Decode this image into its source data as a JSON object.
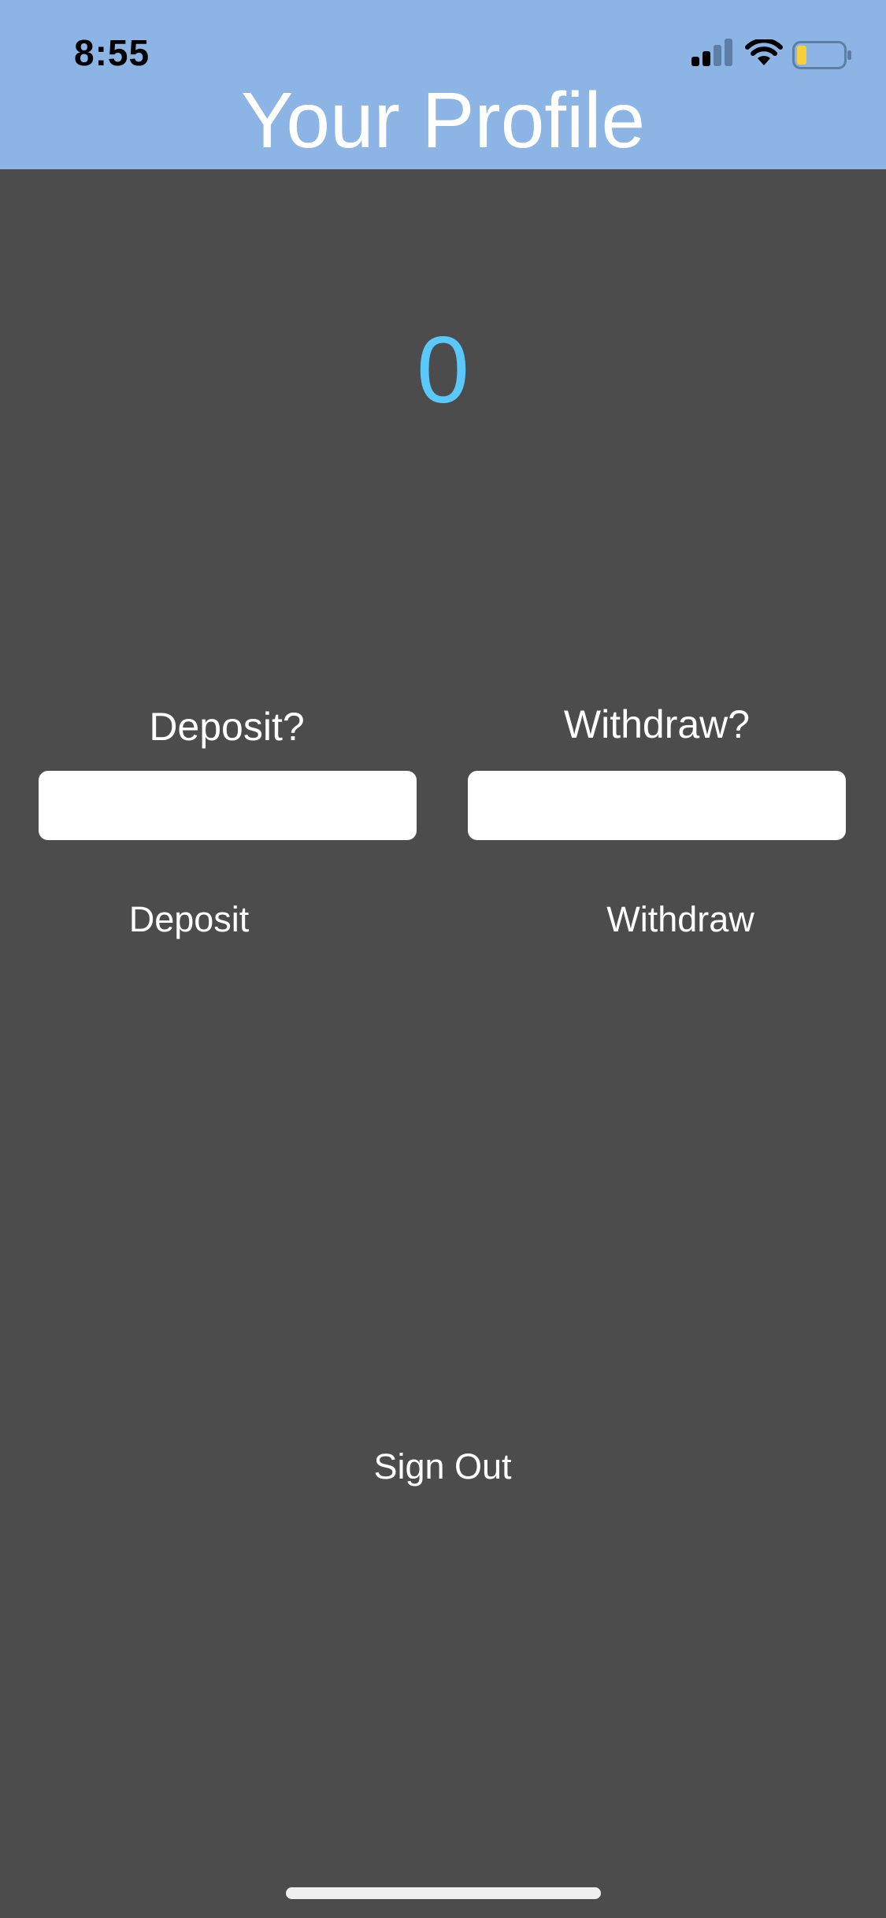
{
  "status_bar": {
    "time": "8:55",
    "icons": [
      "signal-icon",
      "wifi-icon",
      "battery-icon"
    ],
    "battery_color": "#f5d03b"
  },
  "header": {
    "title": "Your Profile",
    "background": "#8cb4e4"
  },
  "profile": {
    "balance": "0",
    "balance_color": "#5ac8fa"
  },
  "deposit": {
    "prompt": "Deposit?",
    "value": "",
    "button_label": "Deposit"
  },
  "withdraw": {
    "prompt": "Withdraw?",
    "value": "",
    "button_label": "Withdraw"
  },
  "actions": {
    "sign_out_label": "Sign Out"
  }
}
